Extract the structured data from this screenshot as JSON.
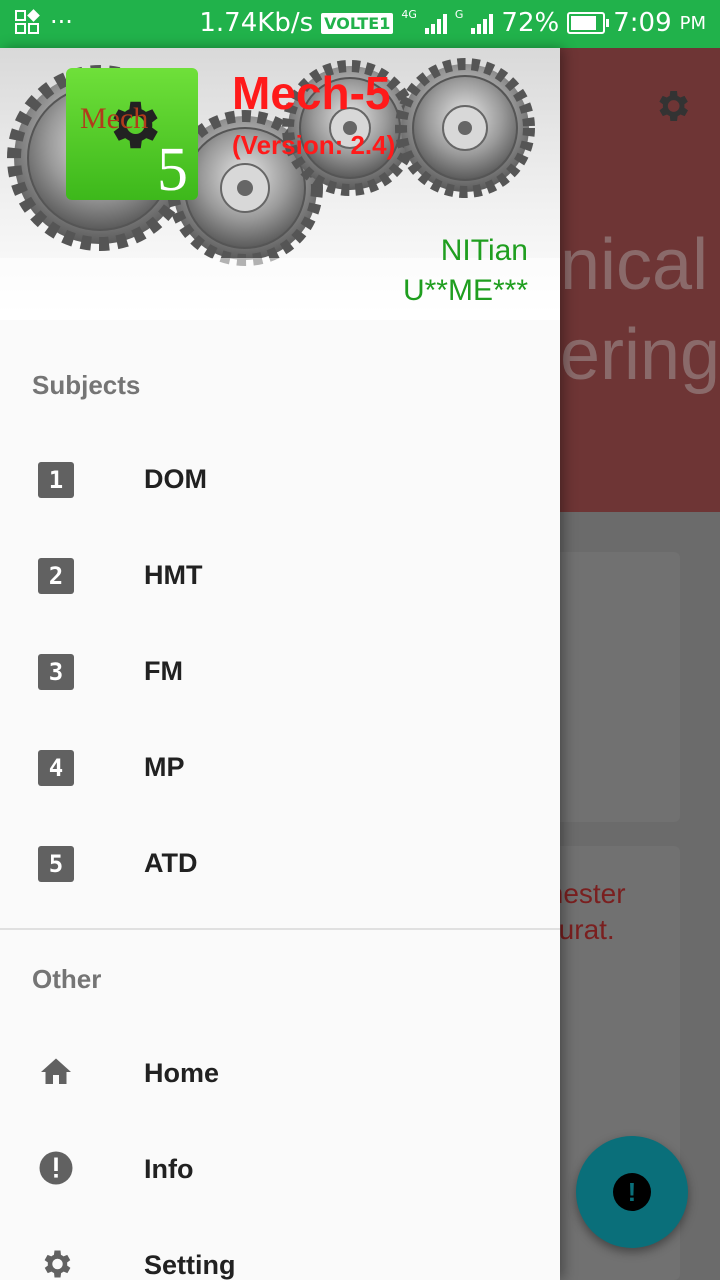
{
  "status_bar": {
    "speed": "1.74Kb/s",
    "volte": "VOLTE1",
    "net1": "4G",
    "net2": "4G",
    "net3": "G",
    "battery": "72%",
    "time": "7:09",
    "ampm": "PM"
  },
  "background": {
    "title_line1": "nical",
    "title_line2": "ering",
    "card_text": "mester\nSurat."
  },
  "header": {
    "logo_text": "Mech",
    "logo_number": "5",
    "app_name": "Mech-5",
    "version": "(Version: 2.4)",
    "user_line1": "NITian",
    "user_line2": "U**ME***"
  },
  "subjects": {
    "label": "Subjects",
    "items": [
      {
        "num": "1",
        "label": "DOM"
      },
      {
        "num": "2",
        "label": "HMT"
      },
      {
        "num": "3",
        "label": "FM"
      },
      {
        "num": "4",
        "label": "MP"
      },
      {
        "num": "5",
        "label": "ATD"
      }
    ]
  },
  "other": {
    "label": "Other",
    "items": [
      {
        "icon": "home-icon",
        "label": "Home"
      },
      {
        "icon": "info-icon",
        "label": "Info"
      },
      {
        "icon": "settings-icon",
        "label": "Setting"
      }
    ]
  },
  "fab": {
    "icon": "alert-icon",
    "glyph": "!"
  },
  "colors": {
    "status_bar": "#21b24b",
    "app_title": "#ff1a1a",
    "user_text": "#1f9e1f",
    "fab": "#0a6f7a"
  }
}
